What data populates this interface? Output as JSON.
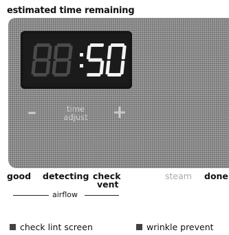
{
  "header": {
    "caption": "estimated time remaining"
  },
  "display": {
    "digits": "88:50",
    "dim_digits": "88",
    "lit_digits": "50"
  },
  "controls": {
    "decrease_label": "–",
    "increase_label": "+",
    "time_adjust_line1": "time",
    "time_adjust_line2": "adjust"
  },
  "status": {
    "good": "good",
    "detecting": "detecting",
    "check_vent_line1": "check",
    "check_vent_line2": "vent",
    "steam": "steam",
    "done": "done",
    "airflow": "airflow"
  },
  "indicators": {
    "check_lint_screen": "check lint screen",
    "wrinkle_prevent": "wrinkle prevent"
  },
  "colors": {
    "panel": "#8c8c8c",
    "display_bg": "#1b1b1b",
    "lit": "#f2f2f2",
    "unlit": "#4a4a4a"
  }
}
